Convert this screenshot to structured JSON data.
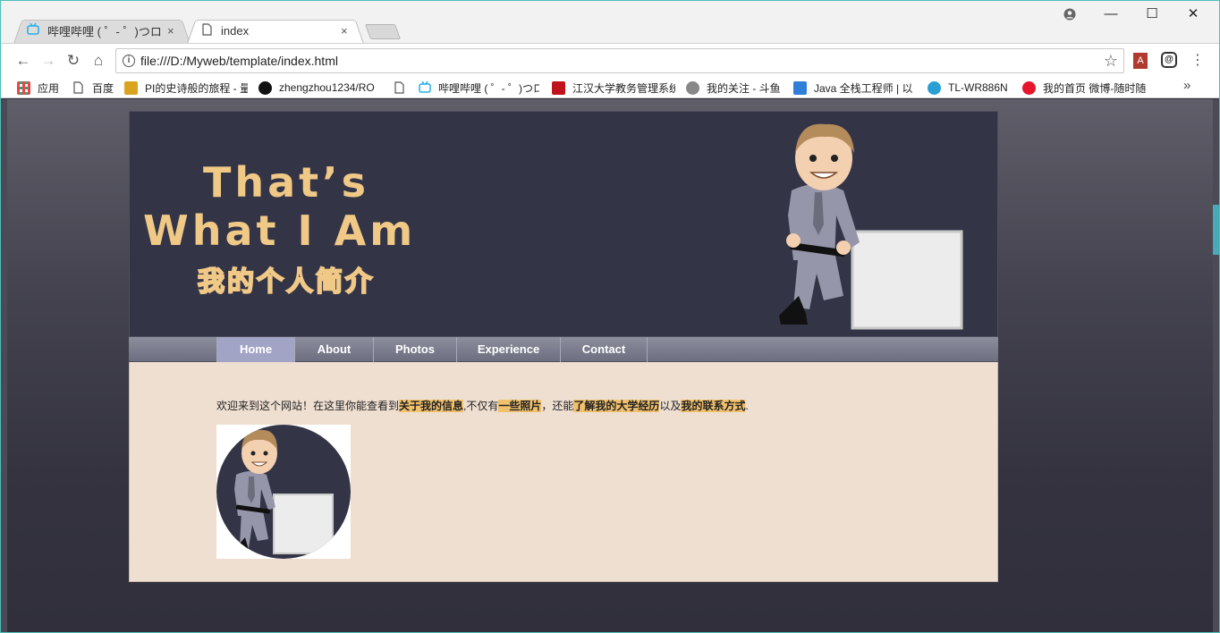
{
  "browser": {
    "tabs": [
      {
        "title": "哔哩哔哩 ( ゜- ゜)つロ 干杯",
        "favicon": "bilibili-icon",
        "active": false
      },
      {
        "title": "index",
        "favicon": "document-icon",
        "active": true
      }
    ],
    "tab_close": "×",
    "window_controls": {
      "minimize": "—",
      "maximize": "☐",
      "close": "✕"
    },
    "nav": {
      "back": "←",
      "forward": "→",
      "reload": "↻",
      "home": "⌂"
    },
    "url": "file:///D:/Myweb/template/index.html",
    "star": "☆",
    "menu": "⋮",
    "extensions": [
      {
        "name": "pdf-extension-icon",
        "glyph": "A"
      },
      {
        "name": "sync-extension-icon",
        "glyph": "@"
      }
    ],
    "bookmarks": [
      {
        "label": "应用",
        "icon": "apps-icon",
        "color": "#e44"
      },
      {
        "label": "百度",
        "icon": "document-icon",
        "color": ""
      },
      {
        "label": "PI的史诗般的旅程 - 量",
        "icon": "bookmark-pi-icon",
        "color": "#d9a520"
      },
      {
        "label": "zhengzhou1234/RO",
        "icon": "github-icon",
        "color": "#111"
      },
      {
        "label": "",
        "icon": "document-icon",
        "color": ""
      },
      {
        "label": "哔哩哔哩 ( ゜- ゜)つロ",
        "icon": "bilibili-icon",
        "color": "#23ade5"
      },
      {
        "label": "江汉大学教务管理系统",
        "icon": "university-icon",
        "color": "#c0121b"
      },
      {
        "label": "我的关注 - 斗鱼",
        "icon": "douyu-icon",
        "color": "#888"
      },
      {
        "label": "Java 全栈工程师 | 以",
        "icon": "java-icon",
        "color": "#2f7fd8"
      },
      {
        "label": "TL-WR886N",
        "icon": "tplink-icon",
        "color": "#2a9fd6"
      },
      {
        "label": "我的首页 微博-随时随",
        "icon": "weibo-icon",
        "color": "#e6162d"
      }
    ],
    "bookmarks_more": "»"
  },
  "site": {
    "logo": {
      "line1": "That’s",
      "line2": "What I Am",
      "line3": "我的个人简介",
      "color": "#f0c987"
    },
    "nav": [
      {
        "label": "Home",
        "active": true
      },
      {
        "label": "About",
        "active": false
      },
      {
        "label": "Photos",
        "active": false
      },
      {
        "label": "Experience",
        "active": false
      },
      {
        "label": "Contact",
        "active": false
      }
    ],
    "intro": {
      "t1": "欢迎来到这个网站！在这里你能查看到",
      "h1": "关于我的信息",
      "t2": ",不仅有",
      "h2": "一些照片",
      "t3": "，还能",
      "h3": "了解我的大学经历",
      "t4": "以及",
      "h4": "我的联系方式",
      "t5": "."
    },
    "colors": {
      "banner": "#343447",
      "content": "#eedfd1",
      "highlight": "#f0c06c",
      "nav_active": "#a2a4c6"
    }
  }
}
